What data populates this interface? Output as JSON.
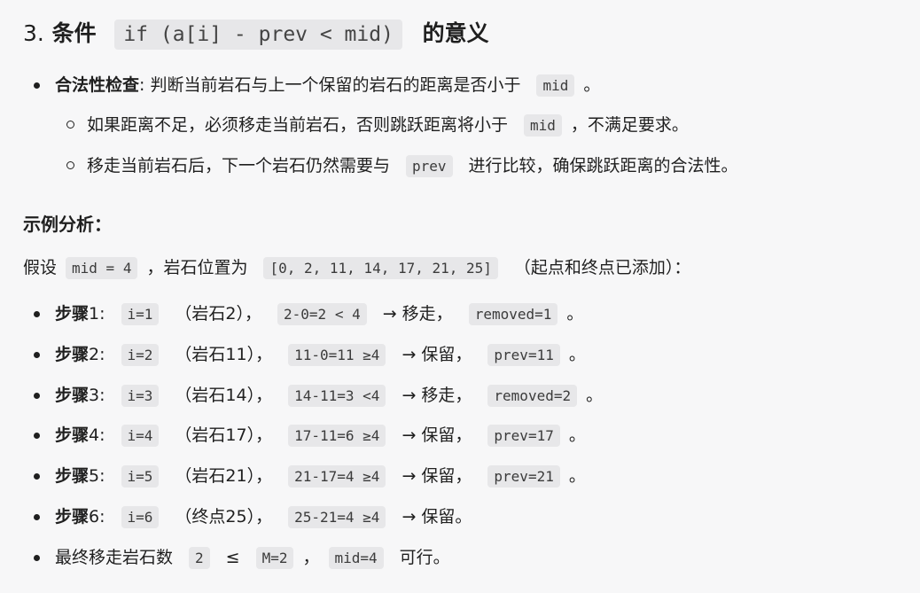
{
  "heading": {
    "number": "3.",
    "word": "条件",
    "code": "if (a[i] - prev < mid)",
    "suffix": "的意义"
  },
  "legality": {
    "label": "合法性检查",
    "colon": ":",
    "text": "判断当前岩石与上一个保留的岩石的距离是否小于",
    "code": "mid",
    "end": "。",
    "sub1": {
      "text": "如果距离不足，必须移走当前岩石，否则跳跃距离将小于",
      "code": "mid",
      "end": "，不满足要求。"
    },
    "sub2": {
      "text": "移走当前岩石后，下一个岩石仍然需要与",
      "code": "prev",
      "end": "进行比较，确保跳跃距离的合法性。"
    }
  },
  "example": {
    "title": "示例分析：",
    "intro_a": "假设",
    "intro_code1": "mid = 4",
    "intro_b": "，岩石位置为",
    "intro_code2": "[0, 2, 11, 14, 17, 21, 25]",
    "intro_c": "（起点和终点已添加）："
  },
  "steps": [
    {
      "label": "步骤",
      "n": "1",
      "colon": ":",
      "i": "i=1",
      "rock": "（岩石2），",
      "calc": "2-0=2 < 4",
      "action": "→ 移走，",
      "result": "removed=1",
      "end": "。"
    },
    {
      "label": "步骤",
      "n": "2",
      "colon": ":",
      "i": "i=2",
      "rock": "（岩石11），",
      "calc": "11-0=11 ≥4",
      "action": "→ 保留，",
      "result": "prev=11",
      "end": "。"
    },
    {
      "label": "步骤",
      "n": "3",
      "colon": ":",
      "i": "i=3",
      "rock": "（岩石14），",
      "calc": "14-11=3 <4",
      "action": "→ 移走，",
      "result": "removed=2",
      "end": "。"
    },
    {
      "label": "步骤",
      "n": "4",
      "colon": ":",
      "i": "i=4",
      "rock": "（岩石17），",
      "calc": "17-11=6 ≥4",
      "action": "→ 保留，",
      "result": "prev=17",
      "end": "。"
    },
    {
      "label": "步骤",
      "n": "5",
      "colon": ":",
      "i": "i=5",
      "rock": "（岩石21），",
      "calc": "21-17=4 ≥4",
      "action": "→ 保留，",
      "result": "prev=21",
      "end": "。"
    },
    {
      "label": "步骤",
      "n": "6",
      "colon": ":",
      "i": "i=6",
      "rock": "（终点25），",
      "calc": "25-21=4 ≥4",
      "action": "→ 保留。",
      "result": "",
      "end": ""
    }
  ],
  "final": {
    "text": "最终移走岩石数",
    "code1": "2",
    "le": "≤",
    "code2": "M=2",
    "comma": "，",
    "code3": "mid=4",
    "end": "可行。"
  }
}
